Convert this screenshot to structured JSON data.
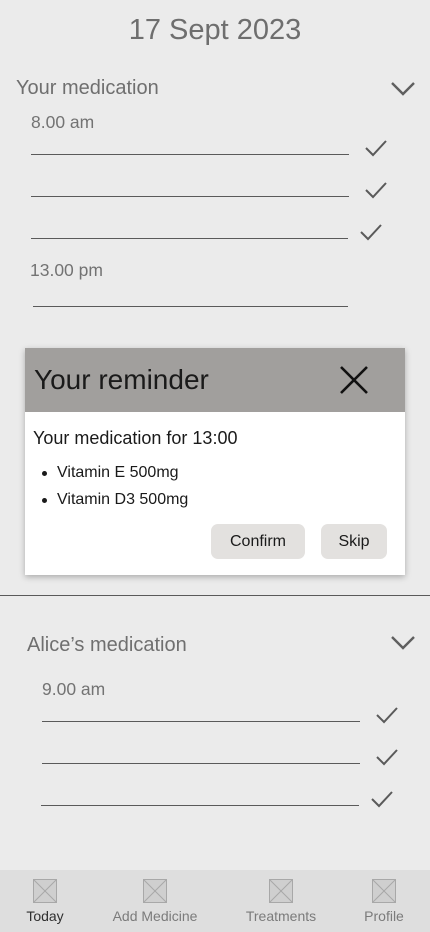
{
  "header": {
    "date": "17 Sept 2023"
  },
  "my_medication": {
    "title": "Your medication",
    "chevron_icon": "chevron-down-icon",
    "groups": [
      {
        "time": "8.00 am",
        "entries_taken": 3
      },
      {
        "time": "13.00 pm",
        "entries_taken": 0
      }
    ]
  },
  "reminder": {
    "title": "Your reminder",
    "close_icon": "close-icon",
    "subtitle": "Your medication for 13:00",
    "items": [
      "Vitamin E 500mg",
      "Vitamin D3 500mg"
    ],
    "confirm_label": "Confirm",
    "skip_label": "Skip",
    "header_color": "#a19f9d"
  },
  "alice_medication": {
    "title": "Alice’s medication",
    "chevron_icon": "chevron-down-icon",
    "groups": [
      {
        "time": "9.00 am",
        "entries_taken": 3
      }
    ]
  },
  "nav": {
    "items": [
      {
        "label": "Today",
        "icon": "image-placeholder-icon",
        "active": true
      },
      {
        "label": "Add Medicine",
        "icon": "image-placeholder-icon",
        "active": false
      },
      {
        "label": "Treatments",
        "icon": "image-placeholder-icon",
        "active": false
      },
      {
        "label": "Profile",
        "icon": "image-placeholder-icon",
        "active": false
      }
    ]
  }
}
